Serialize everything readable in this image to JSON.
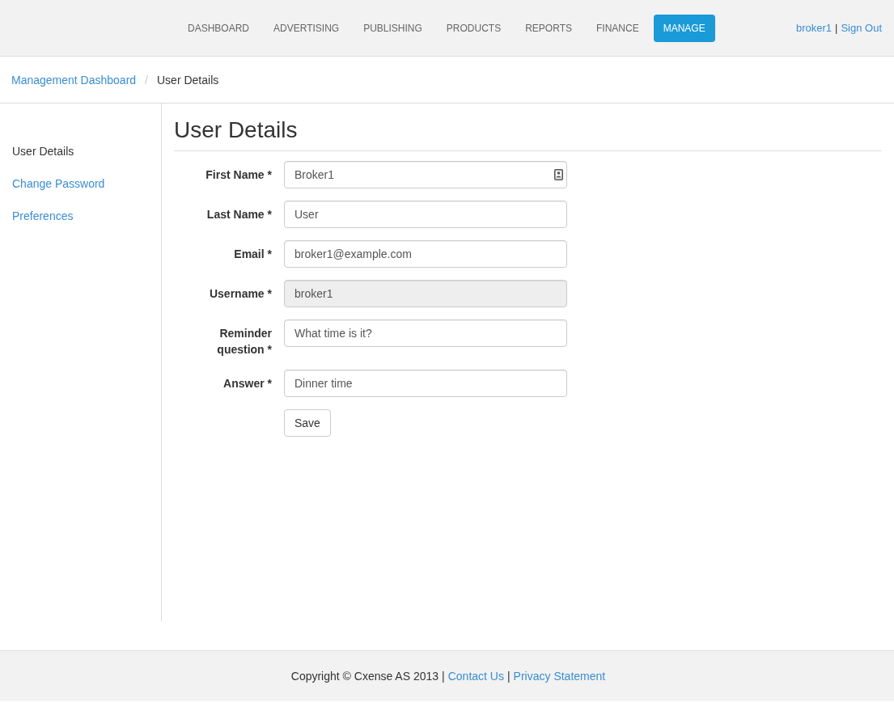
{
  "navbar": {
    "tabs": [
      {
        "label": "DASHBOARD",
        "selected": false
      },
      {
        "label": "ADVERTISING",
        "selected": false
      },
      {
        "label": "PUBLISHING",
        "selected": false
      },
      {
        "label": "PRODUCTS",
        "selected": false
      },
      {
        "label": "REPORTS",
        "selected": false
      },
      {
        "label": "FINANCE",
        "selected": false
      },
      {
        "label": "MANAGE",
        "selected": true
      }
    ],
    "user_menu": [
      {
        "kind": "link",
        "text": "broker1"
      },
      {
        "kind": "separator",
        "text": "|"
      },
      {
        "kind": "link",
        "text": "Sign Out"
      }
    ]
  },
  "breadcrumb": [
    {
      "kind": "link",
      "text": "Management Dashboard"
    },
    {
      "kind": "separator",
      "text": "/"
    },
    {
      "kind": "current",
      "text": "User Details"
    }
  ],
  "sidebar": {
    "items": [
      {
        "label": "User Details",
        "selected": true
      },
      {
        "label": "Change Password",
        "selected": false
      },
      {
        "label": "Preferences",
        "selected": false
      }
    ]
  },
  "page_title": "User Details",
  "form": {
    "fields": [
      {
        "label": "First Name *",
        "value": "Broker1",
        "disabled": false,
        "autofill_icon": true
      },
      {
        "label": "Last Name *",
        "value": "User",
        "disabled": false,
        "autofill_icon": false
      },
      {
        "label": "Email *",
        "value": "broker1@example.com",
        "disabled": false,
        "autofill_icon": false
      },
      {
        "label": "Username *",
        "value": "broker1",
        "disabled": true,
        "autofill_icon": false
      },
      {
        "label": "Reminder question *",
        "value": "What time is it?",
        "disabled": false,
        "autofill_icon": false
      },
      {
        "label": "Answer *",
        "value": "Dinner time",
        "disabled": false,
        "autofill_icon": false
      }
    ],
    "save_button": "Save"
  },
  "footer": [
    {
      "kind": "text",
      "text": "Copyright © Cxense AS 2013"
    },
    {
      "kind": "separator",
      "text": "|"
    },
    {
      "kind": "link",
      "text": "Contact Us"
    },
    {
      "kind": "separator",
      "text": "|"
    },
    {
      "kind": "link",
      "text": "Privacy Statement"
    }
  ]
}
